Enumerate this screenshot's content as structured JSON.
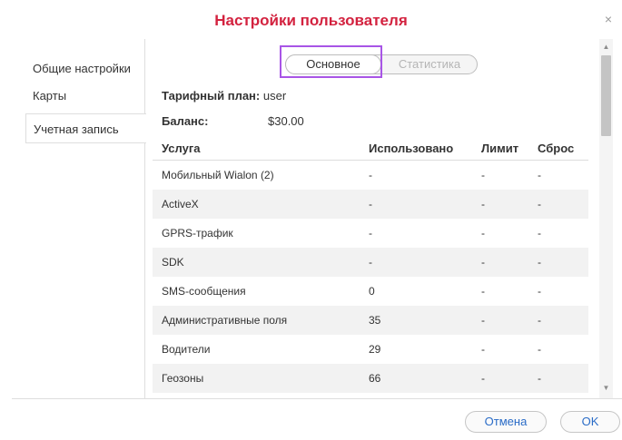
{
  "dialog": {
    "title": "Настройки пользователя",
    "close_glyph": "×"
  },
  "sidebar": {
    "items": [
      {
        "label": "Общие настройки",
        "active": false
      },
      {
        "label": "Карты",
        "active": false
      },
      {
        "label": "Учетная запись",
        "active": true
      }
    ]
  },
  "tabs": [
    {
      "label": "Основное",
      "active": true
    },
    {
      "label": "Статистика",
      "active": false
    }
  ],
  "account": {
    "plan_label": "Тарифный план:",
    "plan_value": "user",
    "balance_label": "Баланс:",
    "balance_value": "$30.00"
  },
  "table": {
    "headers": [
      "Услуга",
      "Использовано",
      "Лимит",
      "Сброс"
    ],
    "rows": [
      [
        "Мобильный Wialon (2)",
        "-",
        "-",
        "-"
      ],
      [
        "ActiveX",
        "-",
        "-",
        "-"
      ],
      [
        "GPRS-трафик",
        "-",
        "-",
        "-"
      ],
      [
        "SDK",
        "-",
        "-",
        "-"
      ],
      [
        "SMS-сообщения",
        "0",
        "-",
        "-"
      ],
      [
        "Административные поля",
        "35",
        "-",
        "-"
      ],
      [
        "Водители",
        "29",
        "-",
        "-"
      ],
      [
        "Геозоны",
        "66",
        "-",
        "-"
      ]
    ]
  },
  "scrollbar": {
    "up_glyph": "▲",
    "down_glyph": "▼"
  },
  "footer": {
    "cancel_label": "Отмена",
    "ok_label": "OK"
  },
  "colors": {
    "title": "#d3223f",
    "focus": "#a855e6",
    "link": "#2a6cc7"
  }
}
